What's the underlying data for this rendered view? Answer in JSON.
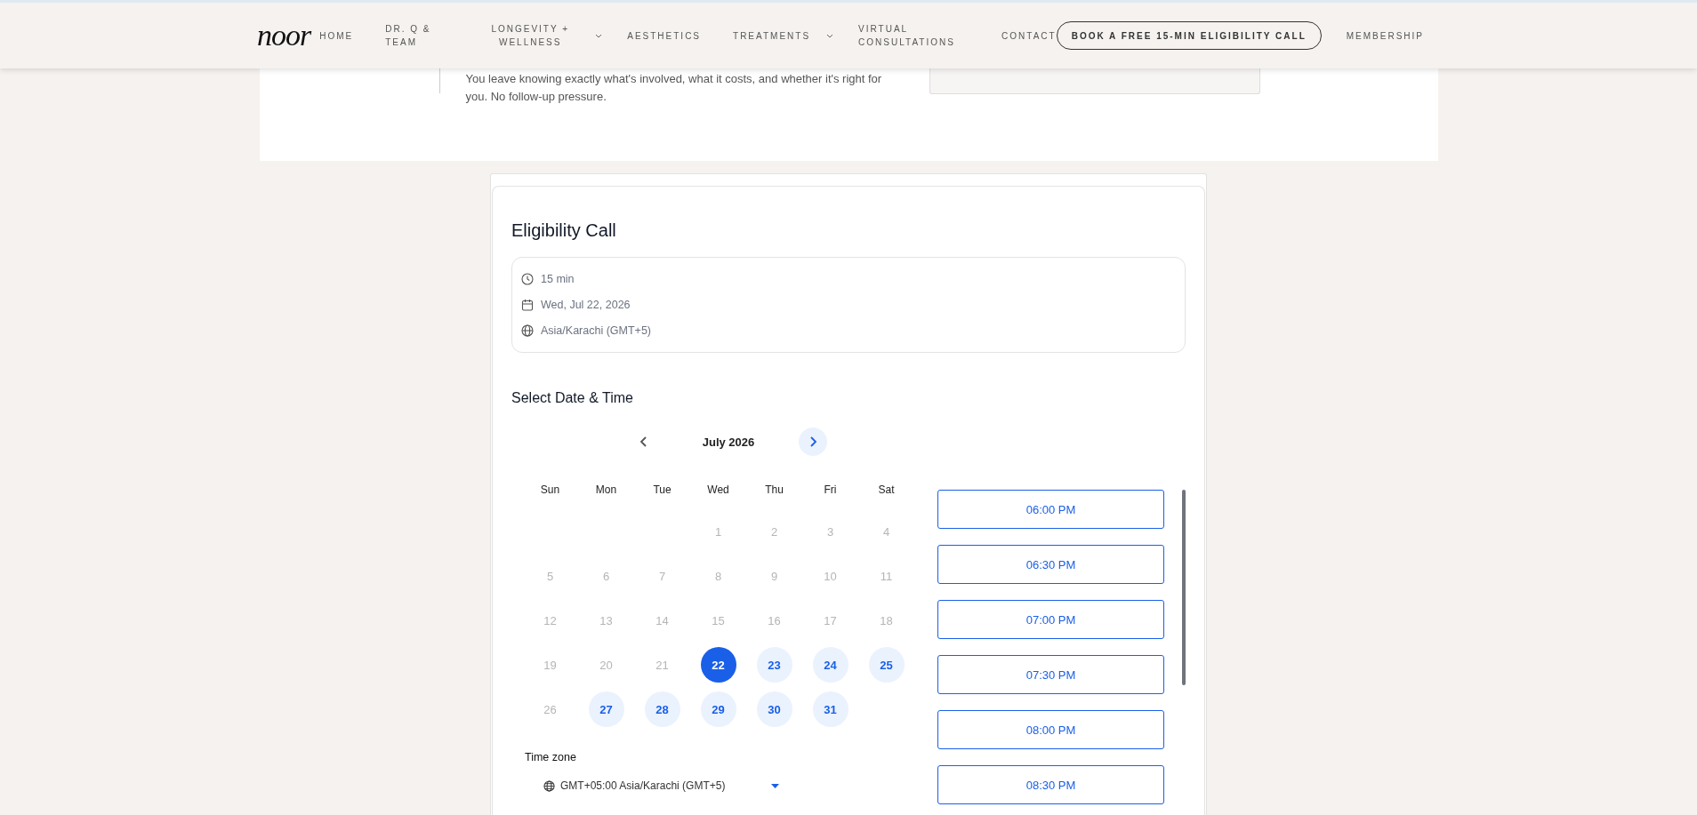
{
  "header": {
    "logo": "noor",
    "nav": [
      {
        "label": "HOME",
        "dropdown": false
      },
      {
        "label": "DR. Q & TEAM",
        "dropdown": false
      },
      {
        "label": "LONGEVITY + WELLNESS",
        "dropdown": true
      },
      {
        "label": "AESTHETICS",
        "dropdown": false
      },
      {
        "label": "TREATMENTS",
        "dropdown": true
      },
      {
        "label": "VIRTUAL CONSULTATIONS",
        "dropdown": false
      },
      {
        "label": "CONTACT",
        "dropdown": false
      }
    ],
    "cta": "BOOK A FREE 15-MIN ELIGIBILITY CALL",
    "membership": "MEMBERSHIP"
  },
  "intro": {
    "text": "You leave knowing exactly what's involved, what it costs, and whether it's right for you. No follow-up pressure."
  },
  "booking": {
    "title": "Eligibility Call",
    "details": [
      {
        "kind": "duration",
        "text": "15 min"
      },
      {
        "kind": "date",
        "text": "Wed, Jul 22, 2026"
      },
      {
        "kind": "timezone",
        "text": "Asia/Karachi (GMT+5)"
      }
    ],
    "section_title": "Select Date & Time",
    "calendar": {
      "month": "July 2026",
      "prev_enabled": false,
      "next_enabled": true,
      "weekdays": [
        "Sun",
        "Mon",
        "Tue",
        "Wed",
        "Thu",
        "Fri",
        "Sat"
      ],
      "weeks": [
        [
          {
            "kind": "empty"
          },
          {
            "kind": "empty"
          },
          {
            "kind": "empty"
          },
          {
            "kind": "day",
            "label": "1",
            "available": false,
            "selected": false
          },
          {
            "kind": "day",
            "label": "2",
            "available": false,
            "selected": false
          },
          {
            "kind": "day",
            "label": "3",
            "available": false,
            "selected": false
          },
          {
            "kind": "day",
            "label": "4",
            "available": false,
            "selected": false
          }
        ],
        [
          {
            "kind": "day",
            "label": "5",
            "available": false,
            "selected": false
          },
          {
            "kind": "day",
            "label": "6",
            "available": false,
            "selected": false
          },
          {
            "kind": "day",
            "label": "7",
            "available": false,
            "selected": false
          },
          {
            "kind": "day",
            "label": "8",
            "available": false,
            "selected": false
          },
          {
            "kind": "day",
            "label": "9",
            "available": false,
            "selected": false
          },
          {
            "kind": "day",
            "label": "10",
            "available": false,
            "selected": false
          },
          {
            "kind": "day",
            "label": "11",
            "available": false,
            "selected": false
          }
        ],
        [
          {
            "kind": "day",
            "label": "12",
            "available": false,
            "selected": false
          },
          {
            "kind": "day",
            "label": "13",
            "available": false,
            "selected": false
          },
          {
            "kind": "day",
            "label": "14",
            "available": false,
            "selected": false
          },
          {
            "kind": "day",
            "label": "15",
            "available": false,
            "selected": false
          },
          {
            "kind": "day",
            "label": "16",
            "available": false,
            "selected": false
          },
          {
            "kind": "day",
            "label": "17",
            "available": false,
            "selected": false
          },
          {
            "kind": "day",
            "label": "18",
            "available": false,
            "selected": false
          }
        ],
        [
          {
            "kind": "day",
            "label": "19",
            "available": false,
            "selected": false
          },
          {
            "kind": "day",
            "label": "20",
            "available": false,
            "selected": false
          },
          {
            "kind": "day",
            "label": "21",
            "available": false,
            "selected": false
          },
          {
            "kind": "day",
            "label": "22",
            "available": true,
            "selected": true
          },
          {
            "kind": "day",
            "label": "23",
            "available": true,
            "selected": false
          },
          {
            "kind": "day",
            "label": "24",
            "available": true,
            "selected": false
          },
          {
            "kind": "day",
            "label": "25",
            "available": true,
            "selected": false
          }
        ],
        [
          {
            "kind": "day",
            "label": "26",
            "available": false,
            "selected": false
          },
          {
            "kind": "day",
            "label": "27",
            "available": true,
            "selected": false
          },
          {
            "kind": "day",
            "label": "28",
            "available": true,
            "selected": false
          },
          {
            "kind": "day",
            "label": "29",
            "available": true,
            "selected": false
          },
          {
            "kind": "day",
            "label": "30",
            "available": true,
            "selected": false
          },
          {
            "kind": "day",
            "label": "31",
            "available": true,
            "selected": false
          },
          {
            "kind": "empty"
          }
        ]
      ]
    },
    "timezone_label": "Time zone",
    "timezone_value": "GMT+05:00 Asia/Karachi (GMT+5)",
    "slots": [
      {
        "time": "06:00 PM",
        "selected": false
      },
      {
        "time": "06:30 PM",
        "selected": false
      },
      {
        "time": "07:00 PM",
        "selected": false
      },
      {
        "time": "07:30 PM",
        "selected": false
      },
      {
        "time": "08:00 PM",
        "selected": false
      },
      {
        "time": "08:30 PM",
        "selected": false
      }
    ]
  }
}
